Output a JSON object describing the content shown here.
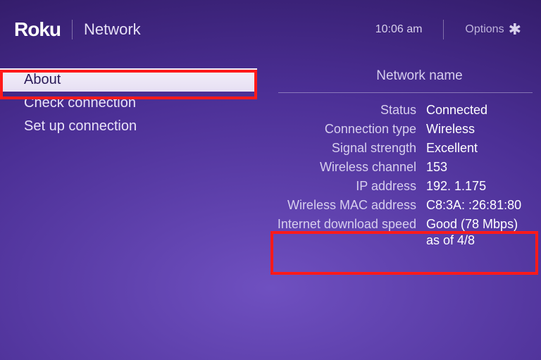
{
  "header": {
    "logo": "Roku",
    "title": "Network",
    "clock": "10:06 am",
    "options_label": "Options"
  },
  "menu": {
    "items": [
      {
        "label": "About",
        "selected": true
      },
      {
        "label": "Check connection",
        "selected": false
      },
      {
        "label": "Set up connection",
        "selected": false
      }
    ]
  },
  "details": {
    "network_name_label": "Network name",
    "rows": {
      "status": {
        "label": "Status",
        "value": "Connected"
      },
      "connection_type": {
        "label": "Connection type",
        "value": "Wireless"
      },
      "signal_strength": {
        "label": "Signal strength",
        "value": "Excellent"
      },
      "wireless_channel": {
        "label": "Wireless channel",
        "value": "153"
      },
      "ip_address": {
        "label": "IP address",
        "value": "192.    1.175"
      },
      "mac_address": {
        "label": "Wireless MAC address",
        "value": "C8:3A:   :26:81:80"
      },
      "download_speed": {
        "label": "Internet download speed",
        "value": "Good (78 Mbps)",
        "value2": "as of 4/8"
      }
    }
  }
}
